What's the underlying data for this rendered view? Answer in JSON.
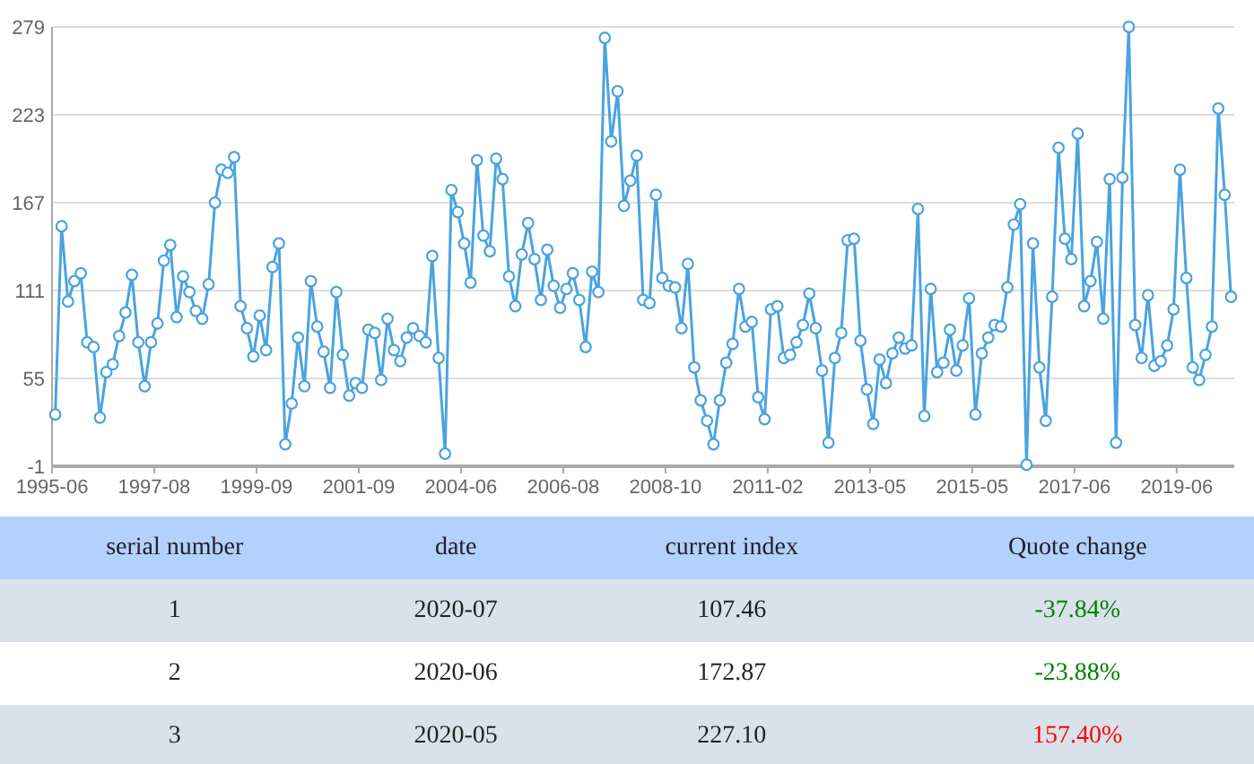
{
  "chart": {
    "chart_data": {
      "type": "line",
      "categories": [
        "1995-06",
        null,
        null,
        null,
        null,
        null,
        null,
        null,
        null,
        null,
        null,
        null,
        null,
        null,
        null,
        null,
        "1997-08",
        null,
        null,
        null,
        null,
        null,
        null,
        null,
        null,
        null,
        null,
        null,
        null,
        null,
        null,
        null,
        "1999-09",
        null,
        null,
        null,
        null,
        null,
        null,
        null,
        null,
        null,
        null,
        null,
        null,
        null,
        null,
        null,
        "2001-09",
        null,
        null,
        null,
        null,
        null,
        null,
        null,
        null,
        null,
        null,
        null,
        null,
        null,
        null,
        null,
        "2004-06",
        null,
        null,
        null,
        null,
        null,
        null,
        null,
        null,
        null,
        null,
        null,
        null,
        null,
        null,
        null,
        "2006-08",
        null,
        null,
        null,
        null,
        null,
        null,
        null,
        null,
        null,
        null,
        null,
        null,
        null,
        null,
        null,
        "2008-10",
        null,
        null,
        null,
        null,
        null,
        null,
        null,
        null,
        null,
        null,
        null,
        null,
        null,
        null,
        null,
        "2011-02",
        null,
        null,
        null,
        null,
        null,
        null,
        null,
        null,
        null,
        null,
        null,
        null,
        null,
        null,
        null,
        "2013-05",
        null,
        null,
        null,
        null,
        null,
        null,
        null,
        null,
        null,
        null,
        null,
        null,
        null,
        null,
        null,
        "2015-05",
        null,
        null,
        null,
        null,
        null,
        null,
        null,
        null,
        null,
        null,
        null,
        null,
        null,
        null,
        null,
        "2017-06",
        null,
        null,
        null,
        null,
        null,
        null,
        null,
        null,
        null,
        null,
        null,
        null,
        null,
        null,
        null,
        "2019-06",
        null,
        null,
        null,
        null,
        null,
        null,
        null,
        null
      ],
      "grid": true,
      "yticks": [
        -1,
        55,
        111,
        167,
        223,
        279
      ],
      "ylim": [
        -1,
        279
      ],
      "series": [
        {
          "color": "#4aa3e0",
          "marker": "circle",
          "values": [
            32,
            152,
            104,
            117,
            122,
            78,
            75,
            30,
            59,
            64,
            82,
            97,
            121,
            78,
            50,
            78,
            90,
            130,
            140,
            94,
            120,
            110,
            98,
            93,
            115,
            167,
            188,
            186,
            196,
            101,
            87,
            69,
            95,
            73,
            126,
            141,
            13,
            39,
            81,
            50,
            117,
            88,
            72,
            49,
            110,
            70,
            44,
            52,
            49,
            86,
            84,
            54,
            93,
            73,
            66,
            81,
            87,
            82,
            78,
            133,
            68,
            7,
            175,
            161,
            141,
            116,
            194,
            146,
            136,
            195,
            182,
            120,
            101,
            134,
            154,
            131,
            105,
            137,
            114,
            100,
            112,
            122,
            105,
            75,
            123,
            110,
            272,
            206,
            238,
            165,
            181,
            197,
            105,
            103,
            172,
            119,
            114,
            113,
            87,
            128,
            62,
            41,
            28,
            13,
            41,
            65,
            77,
            112,
            88,
            91,
            43,
            29,
            99,
            101,
            68,
            70,
            78,
            89,
            109,
            87,
            60,
            14,
            68,
            84,
            143,
            144,
            79,
            48,
            26,
            67,
            52,
            71,
            81,
            74,
            76,
            163,
            31,
            112,
            59,
            65,
            86,
            60,
            76,
            106,
            32,
            71,
            81,
            89,
            88,
            113,
            153,
            166,
            0,
            141,
            62,
            28,
            107,
            202,
            144,
            131,
            211,
            101,
            117,
            142,
            93,
            182,
            14,
            183,
            279,
            89,
            68,
            108,
            63,
            66,
            76,
            99,
            188,
            119,
            62,
            54,
            70,
            88,
            227,
            172,
            107
          ]
        }
      ]
    }
  },
  "table": {
    "columns": [
      "serial number",
      "date",
      "current index",
      "Quote change"
    ],
    "rows": [
      {
        "serial": "1",
        "date": "2020-07",
        "index": "107.46",
        "change": "-37.84%",
        "color": "#008000"
      },
      {
        "serial": "2",
        "date": "2020-06",
        "index": "172.87",
        "change": "-23.88%",
        "color": "#008000"
      },
      {
        "serial": "3",
        "date": "2020-05",
        "index": "227.10",
        "change": "157.40%",
        "color": "#ff0000"
      }
    ]
  }
}
